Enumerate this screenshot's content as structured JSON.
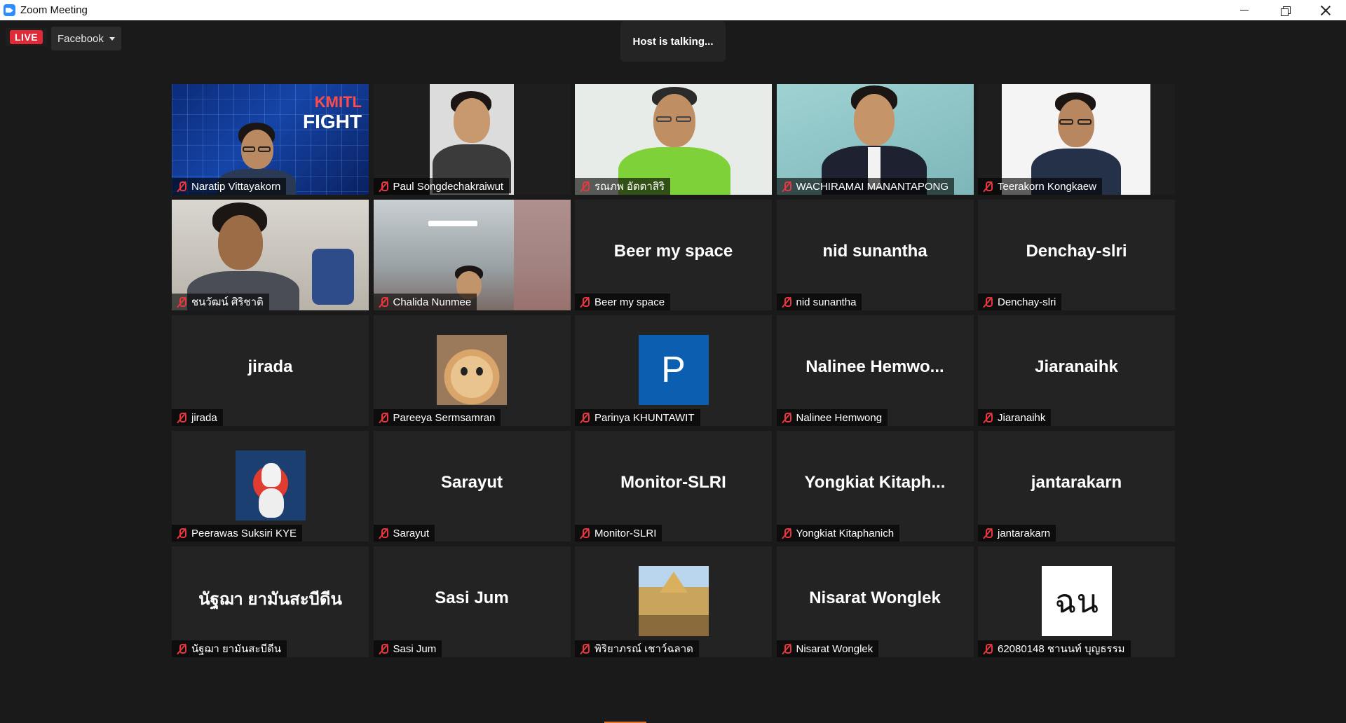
{
  "window": {
    "title": "Zoom Meeting"
  },
  "live": {
    "badge": "LIVE",
    "platform": "Facebook"
  },
  "talking_indicator": "Host is talking...",
  "colors": {
    "live_red": "#e02a37",
    "mute_red": "#e8363e",
    "tile_bg": "#232323",
    "window_bg": "#1a1a1a"
  },
  "tiles": [
    {
      "name": "Naratip Vittayakorn",
      "display": "video",
      "muted": true
    },
    {
      "name": "Paul Songdechakraiwut",
      "display": "video",
      "muted": true
    },
    {
      "name": "รณภพ อัตตาสิริ",
      "display": "video",
      "muted": true
    },
    {
      "name": "WACHIRAMAI MANANTAPONG",
      "display": "video",
      "muted": true
    },
    {
      "name": "Teerakorn Kongkaew",
      "display": "video",
      "muted": true
    },
    {
      "name": "ชนวัฒน์ ศิริชาติ",
      "display": "video",
      "muted": true
    },
    {
      "name": "Chalida Nunmee",
      "display": "video",
      "muted": true
    },
    {
      "name": "Beer my space",
      "display": "name",
      "center_text": "Beer my space",
      "muted": true
    },
    {
      "name": "nid sunantha",
      "display": "name",
      "center_text": "nid sunantha",
      "muted": true
    },
    {
      "name": "Denchay-slri",
      "display": "name",
      "center_text": "Denchay-slri",
      "muted": true
    },
    {
      "name": "jirada",
      "display": "name",
      "center_text": "jirada",
      "muted": true
    },
    {
      "name": "Pareeya Sermsamran",
      "display": "avatar",
      "avatar": "cat-avatar",
      "muted": true
    },
    {
      "name": "Parinya KHUNTAWIT",
      "display": "avatar",
      "avatar": "letter-avatar",
      "avatar_text": "P",
      "muted": true
    },
    {
      "name": "Nalinee Hemwong",
      "display": "name",
      "center_text": "Nalinee  Hemwo...",
      "muted": true
    },
    {
      "name": "Jiaranaihk",
      "display": "name",
      "center_text": "Jiaranaihk",
      "muted": true
    },
    {
      "name": "Peerawas Suksiri KYE",
      "display": "avatar",
      "avatar": "stormtrooper-avatar",
      "muted": true
    },
    {
      "name": "Sarayut",
      "display": "name",
      "center_text": "Sarayut",
      "muted": true
    },
    {
      "name": "Monitor-SLRI",
      "display": "name",
      "center_text": "Monitor-SLRI",
      "muted": true
    },
    {
      "name": "Yongkiat Kitaphanich",
      "display": "name",
      "center_text": "Yongkiat  Kitaph...",
      "muted": true
    },
    {
      "name": "jantarakarn",
      "display": "name",
      "center_text": "jantarakarn",
      "muted": true
    },
    {
      "name": "นัฐฌา ยามันสะบีดีน",
      "display": "name",
      "center_text": "นัฐฌา ยามันสะบีดีน",
      "muted": true
    },
    {
      "name": "Sasi Jum",
      "display": "name",
      "center_text": "Sasi Jum",
      "muted": true
    },
    {
      "name": "พิริยาภรณ์ เชาว์ฉลาด",
      "display": "avatar",
      "avatar": "temple-avatar",
      "muted": true
    },
    {
      "name": "Nisarat Wonglek",
      "display": "name",
      "center_text": "Nisarat Wonglek",
      "muted": true
    },
    {
      "name": "62080148 ชานนท์ บุญธรรม",
      "display": "avatar",
      "avatar": "handwriting-avatar",
      "avatar_text": "ฉน",
      "muted": true
    }
  ],
  "video_overlays": {
    "tile0_logo_top": "KMITL",
    "tile0_logo_bottom": "FIGHT"
  }
}
